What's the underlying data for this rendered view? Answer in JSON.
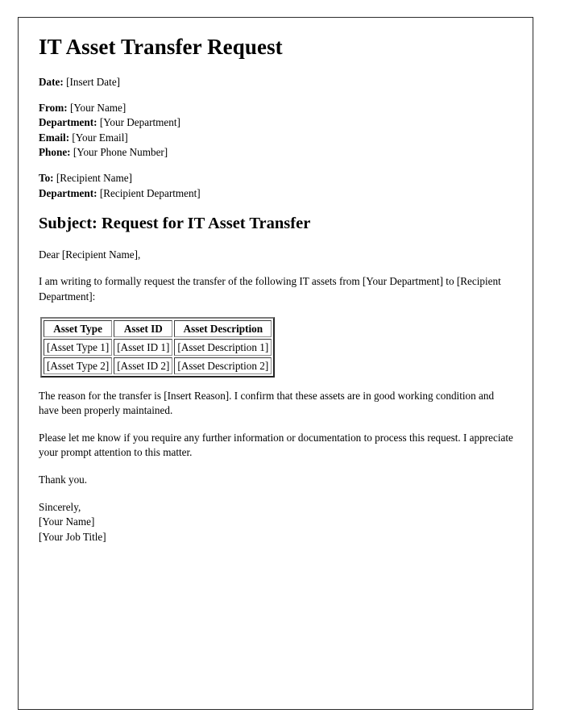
{
  "document": {
    "title": "IT Asset Transfer Request",
    "date": {
      "label": "Date:",
      "value": "[Insert Date]"
    },
    "from_block": [
      {
        "label": "From:",
        "value": "[Your Name]"
      },
      {
        "label": "Department:",
        "value": "[Your Department]"
      },
      {
        "label": "Email:",
        "value": "[Your Email]"
      },
      {
        "label": "Phone:",
        "value": "[Your Phone Number]"
      }
    ],
    "to_block": [
      {
        "label": "To:",
        "value": "[Recipient Name]"
      },
      {
        "label": "Department:",
        "value": "[Recipient Department]"
      }
    ],
    "subject_heading": "Subject: Request for IT Asset Transfer",
    "salutation": "Dear [Recipient Name],",
    "paragraph_intro": "I am writing to formally request the transfer of the following IT assets from [Your Department] to [Recipient Department]:",
    "table": {
      "headers": [
        "Asset Type",
        "Asset ID",
        "Asset Description"
      ],
      "rows": [
        [
          "[Asset Type 1]",
          "[Asset ID 1]",
          "[Asset Description 1]"
        ],
        [
          "[Asset Type 2]",
          "[Asset ID 2]",
          "[Asset Description 2]"
        ]
      ]
    },
    "paragraph_reason": "The reason for the transfer is [Insert Reason]. I confirm that these assets are in good working condition and have been properly maintained.",
    "paragraph_followup": "Please let me know if you require any further information or documentation to process this request. I appreciate your prompt attention to this matter.",
    "thanks": "Thank you.",
    "closing": [
      "Sincerely,",
      "[Your Name]",
      "[Your Job Title]"
    ]
  }
}
